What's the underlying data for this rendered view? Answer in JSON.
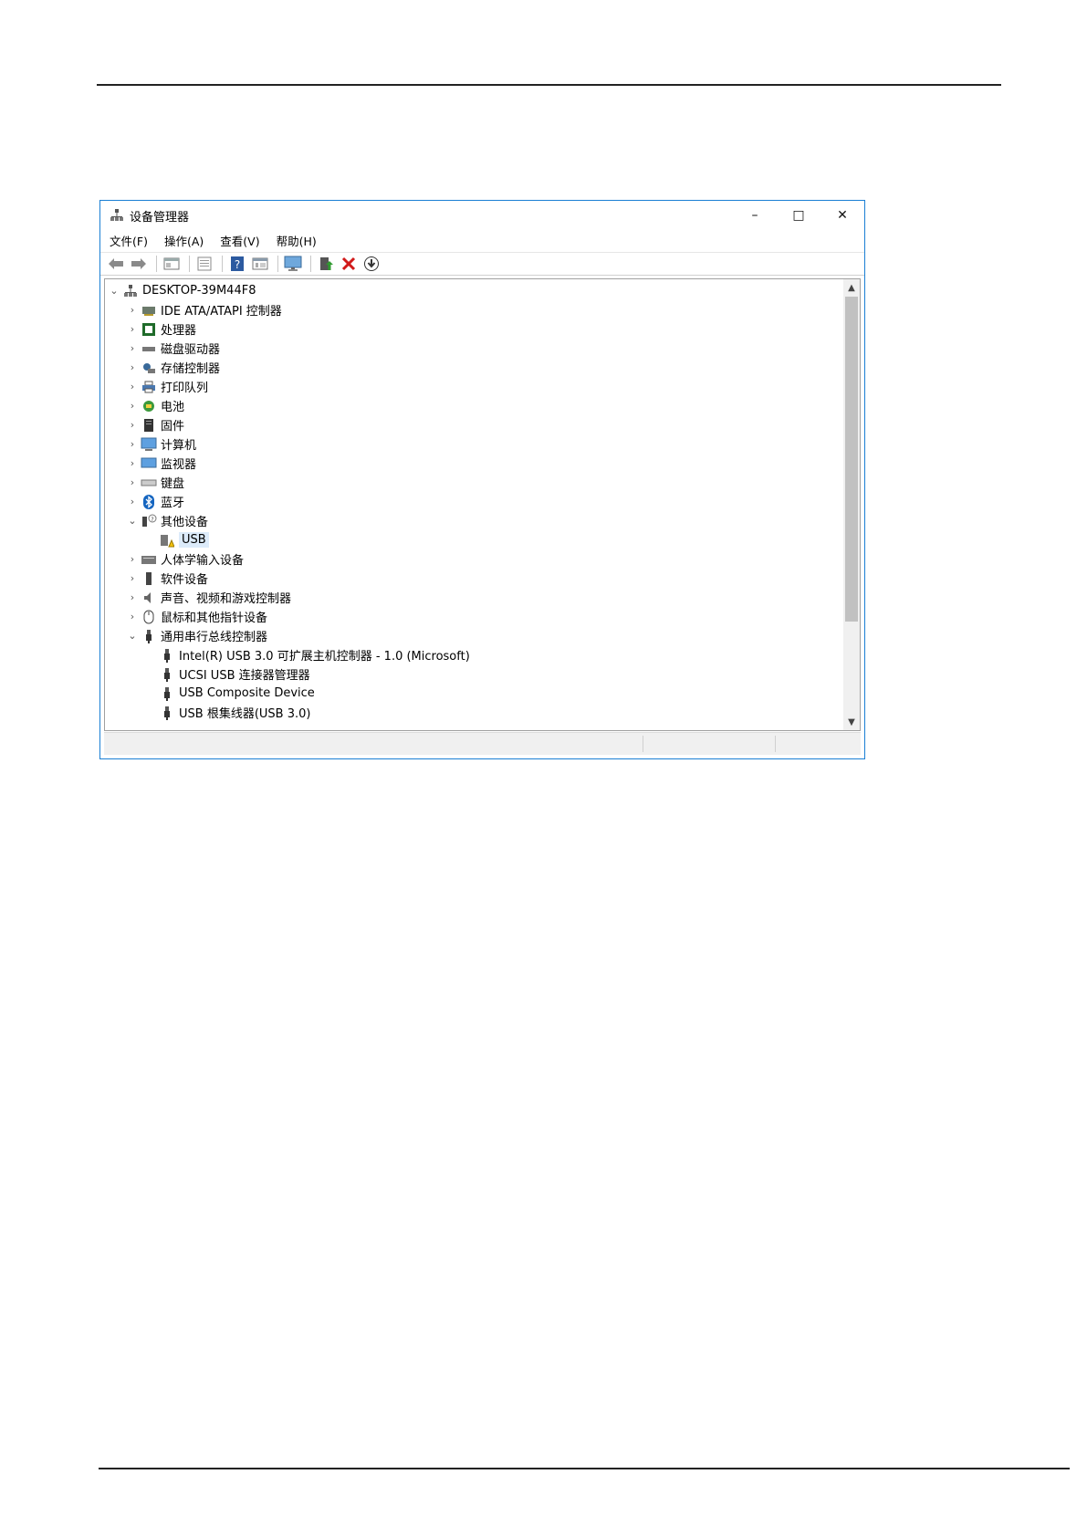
{
  "window": {
    "title": "设备管理器",
    "controls": {
      "minimize": "–",
      "maximize": "□",
      "close": "✕"
    }
  },
  "menu": [
    {
      "label": "文件(F)"
    },
    {
      "label": "操作(A)"
    },
    {
      "label": "查看(V)"
    },
    {
      "label": "帮助(H)"
    }
  ],
  "toolbar": [
    "back-arrow-icon",
    "forward-arrow-icon",
    "properties-icon",
    "details-icon",
    "help-icon",
    "view-icon",
    "monitor-icon",
    "update-driver-icon",
    "uninstall-icon",
    "download-icon"
  ],
  "tree": {
    "root": "DESKTOP-39M44F8",
    "items": [
      {
        "label": "IDE ATA/ATAPI 控制器",
        "icon": "ide-controller-icon",
        "expanded": false
      },
      {
        "label": "处理器",
        "icon": "processor-icon",
        "expanded": false
      },
      {
        "label": "磁盘驱动器",
        "icon": "disk-drive-icon",
        "expanded": false
      },
      {
        "label": "存储控制器",
        "icon": "storage-controller-icon",
        "expanded": false
      },
      {
        "label": "打印队列",
        "icon": "printer-icon",
        "expanded": false
      },
      {
        "label": "电池",
        "icon": "battery-icon",
        "expanded": false
      },
      {
        "label": "固件",
        "icon": "firmware-icon",
        "expanded": false
      },
      {
        "label": "计算机",
        "icon": "computer-icon",
        "expanded": false
      },
      {
        "label": "监视器",
        "icon": "monitor-icon",
        "expanded": false
      },
      {
        "label": "键盘",
        "icon": "keyboard-icon",
        "expanded": false
      },
      {
        "label": "蓝牙",
        "icon": "bluetooth-icon",
        "expanded": false
      },
      {
        "label": "其他设备",
        "icon": "other-devices-icon",
        "expanded": true,
        "children": [
          {
            "label": "USB",
            "icon": "warning-device-icon",
            "selected": true
          }
        ]
      },
      {
        "label": "人体学输入设备",
        "icon": "hid-icon",
        "expanded": false
      },
      {
        "label": "软件设备",
        "icon": "software-device-icon",
        "expanded": false
      },
      {
        "label": "声音、视频和游戏控制器",
        "icon": "speaker-icon",
        "expanded": false
      },
      {
        "label": "鼠标和其他指针设备",
        "icon": "mouse-icon",
        "expanded": false
      },
      {
        "label": "通用串行总线控制器",
        "icon": "usb-icon",
        "expanded": true,
        "children": [
          {
            "label": "Intel(R) USB 3.0 可扩展主机控制器 - 1.0 (Microsoft)",
            "icon": "usb-icon"
          },
          {
            "label": "UCSI USB 连接器管理器",
            "icon": "usb-icon"
          },
          {
            "label": "USB Composite Device",
            "icon": "usb-icon"
          },
          {
            "label": "USB 根集线器(USB 3.0)",
            "icon": "usb-icon"
          }
        ]
      }
    ]
  },
  "colors": {
    "window_border": "#1a7fd4",
    "selection": "#dcebfa",
    "uninstall": "#d11a1a"
  }
}
